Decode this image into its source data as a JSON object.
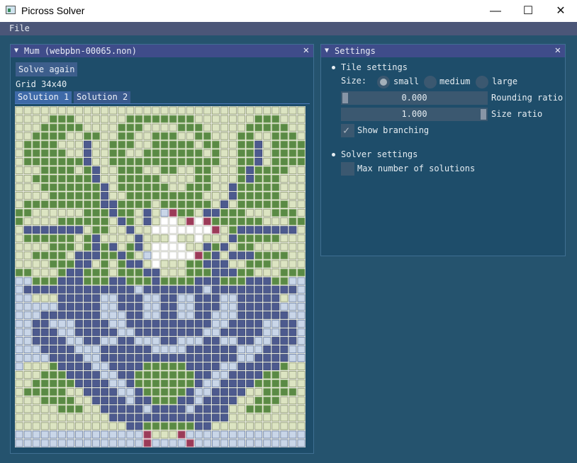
{
  "window": {
    "title": "Picross Solver",
    "minimize": "—",
    "maximize": "☐",
    "close": "✕"
  },
  "menu": {
    "file": "File"
  },
  "puzzle_panel": {
    "title": "Mum (webpbn-00065.non)",
    "solve_again": "Solve again",
    "grid_label": "Grid 34x40",
    "tabs": [
      "Solution 1",
      "Solution 2"
    ],
    "close": "✕",
    "collapse": "▼",
    "grid": {
      "cols": 34,
      "rows": 40,
      "colors": {
        "L": "#dce4c2",
        "G": "#5a8a45",
        "B": "#4d5a8e",
        "P": "#c9d6e8",
        "W": "#ffffff",
        "M": "#9b3b58"
      },
      "pixels": [
        "LLLLLLLLLLLLLLLLLLLLLLLLLLLLLLLLLL",
        "LLLLGGGLLLLLLGGGGGGGGLLLLLLLGGGLLL",
        "LLLGGGGGLLLLGGGLLLLGGGLLLLLGGGGGLL",
        "LLGGGGLLGGLLGGLLGGGLLGGLLLGGLLGGGL",
        "LGGGGLLLBLLGGGLLGGGGGLGGLLGGBLGGGG",
        "LGGGGGLLBLLGGLLGGGGGGGLGLLGGBLGGGG",
        "LGGGGGGGBLLGGGGGGGGGGGGGLLGGBLGGGG",
        "LLLGGGGLGBLLGGGLLGGLLGGLLLGBGGGGLL",
        "LLGGGGGGGBLLGGGGGLLLLGGLLLGBGGGLLL",
        "LLLGGGGGGGBLGGGGGGLLGGGLLBGGGGGLLL",
        "LLLLGGGGGGBLLGGGGGGGGGLLLBGGGGGLLL",
        "LGGGGGGGGGBBGGGGLGGGGGGLBLGGGGGGLL",
        "GGLLLLLLGGGBGGLBLPMGGLBBGGGLLLGGGL",
        "GLLLLGGGGGGLBGLBLWWLMWMGGGGGGLLLGG",
        "LBBBBBBBLGGLLBLLWWWWWWWMLGBBBBBBBL",
        "LGGGGGGLGBLLLLBLLLWLLWLLLBGGGGGLLL",
        "LLLLGGGLGBGBLGBLWWWWLLBGBLGGLLLLLL",
        "LLGGGGLBBBGGBGLPWWWWWMGBLBBBGGGGLL",
        "LLLLGGGBBLGLGBBLWLLLGGBBBLLGGGLLLL",
        "GGLLLGBBGGGLGGGBBLLLGGGBBBGGLLLGGG",
        "PPGGGBBBGGGBBGGGBGGGGBBBGGGBBBGGPP",
        "PBBBBBBBBBBBBBPBBBBBBBPBBBBBBBBBBP",
        "PPLLLBBBBBPPBBBPPBBPPBBBPPBBBBBLPP",
        "PPPPPBBBBBPPBBBPPBBPPBBBPPBBBBBPPP",
        "PPPBBBBBBBPPPBBPPBBPPBBPPPBBBBBBPP",
        "PPBBPPPBBBBPPBBBBBBBBBBPPBBBBPPBBP",
        "PPBBBPPBBBBBPPBBBBBBBBPPBBBBBPPBBP",
        "PPBBBBPPBBPPBBPPPBBPPPBBPPBBPPBBBP",
        "PPPBBBBPPPBBBBBBPPPPBBBBBBPPPBBBPP",
        "PPPPBBBBPPBBBBBBBBBBBBBBBBPPBBBBPP",
        "PLLLGBBBBPPBBBBGGGGGBBBBPPBBBBBGLL",
        "LLLGGGBBBBPPBBGGGGGGGBBPPBBBBGGLLL",
        "LLGGGGGBBBBPPBGGGGGGGBPPBBBBGGGGLL",
        "LGGGGGLLBBBBPPBGGGGGBPPBBBBLLGGGGL",
        "LLLGGGGLLBBBBPBBGGGBBPBBBBLLGGGLLL",
        "LLLLLGGGLLBBBBBPBBBBPBBBBLLGGGLLLL",
        "LLLLLLLLLLLBBBBBBBBBBBBBBLLLLLLLLL",
        "LLLLLLLLLLLLLBBGGGGGGBBLLLLLLLLLLL",
        "PPPPPPPPPPPPPPPMLLLMPPPPPPPPPPPPPP",
        "PPPPPPPPPPPPPPPMPPPPMPPPPPPPPPPPPP"
      ]
    }
  },
  "settings_panel": {
    "title": "Settings",
    "close": "✕",
    "collapse": "▼",
    "tile_settings": "Tile settings",
    "size_label": "Size:",
    "size_options": [
      "small",
      "medium",
      "large"
    ],
    "size_selected": "small",
    "rounding_value": "0.000",
    "rounding_label": "Rounding ratio",
    "rounding_fraction": 0,
    "size_ratio_value": "1.000",
    "size_ratio_label": "Size ratio",
    "size_ratio_fraction": 1,
    "show_branching": "Show branching",
    "show_branching_checked": true,
    "solver_settings": "Solver settings",
    "max_solutions": "Max number of solutions",
    "max_solutions_checked": false
  }
}
